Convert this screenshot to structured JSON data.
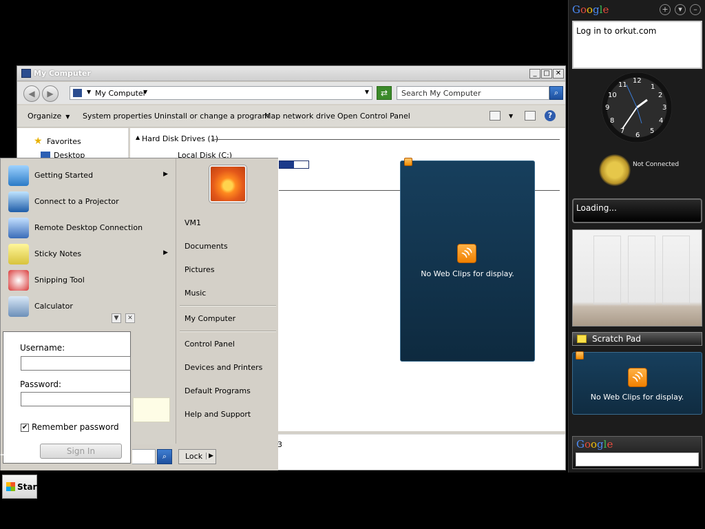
{
  "explorer": {
    "title": "My Computer",
    "address": "My Computer",
    "search_placeholder": "Search My Computer",
    "commands": [
      "Organize",
      "System properties",
      "Uninstall or change a program",
      "Map network drive",
      "Open Control Panel"
    ],
    "nav": {
      "favorites": "Favorites",
      "desktop": "Desktop"
    },
    "group_header": "Hard Disk Drives (1)",
    "drive_label": "Local Disk (C:)",
    "detail_digit": "3"
  },
  "start_menu": {
    "programs": [
      {
        "label": "Getting Started",
        "has_submenu": true
      },
      {
        "label": "Connect to a Projector",
        "has_submenu": false
      },
      {
        "label": "Remote Desktop Connection",
        "has_submenu": false
      },
      {
        "label": "Sticky Notes",
        "has_submenu": true
      },
      {
        "label": "Snipping Tool",
        "has_submenu": false
      },
      {
        "label": "Calculator",
        "has_submenu": false
      }
    ],
    "right_items": [
      "VM1",
      "Documents",
      "Pictures",
      "Music",
      "My Computer",
      "Control Panel",
      "Devices and Printers",
      "Default Programs",
      "Help and Support"
    ],
    "lock_label": "Lock"
  },
  "login": {
    "username_label": "Username:",
    "password_label": "Password:",
    "remember_label": "Remember password",
    "remember_checked": "✔",
    "signin_label": "Sign In"
  },
  "webclip": {
    "empty_text": "No Web Clips for display."
  },
  "sidebar": {
    "logo": "Google",
    "orkut_text": "Log in to orkut.com",
    "clock_numbers": [
      "12",
      "1",
      "2",
      "3",
      "4",
      "5",
      "6",
      "7",
      "8",
      "9",
      "10",
      "11"
    ],
    "weather_status": "Not Connected",
    "loading_text": "Loading...",
    "scratch_pad": "Scratch Pad",
    "webclip_empty": "No Web Clips for display.",
    "search_logo": "Google"
  },
  "taskbar": {
    "start_label": "Start"
  }
}
